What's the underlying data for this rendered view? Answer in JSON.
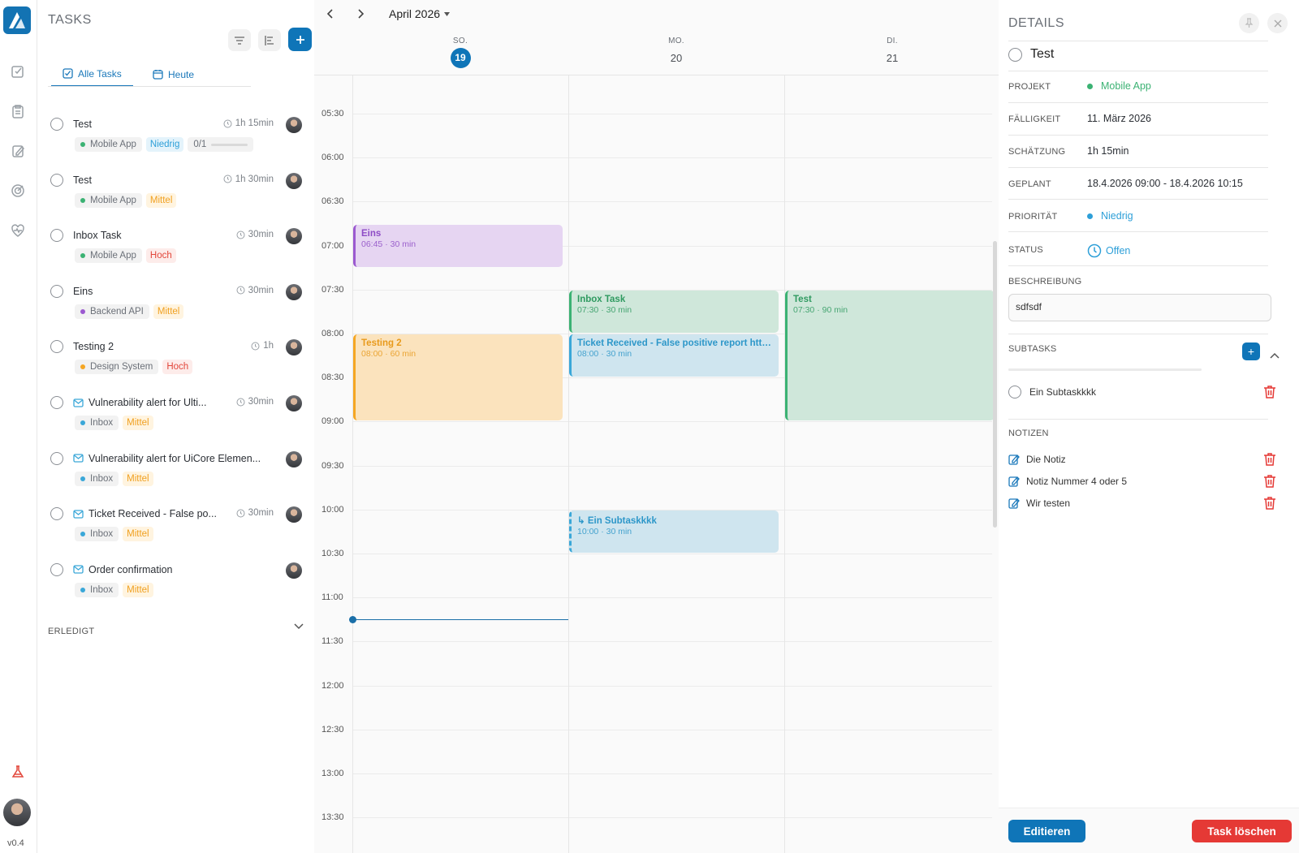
{
  "app": {
    "version": "v0.4",
    "colors": {
      "accent": "#0f75b8",
      "danger": "#e53935"
    }
  },
  "tasks_panel": {
    "title": "TASKS",
    "tabs": [
      {
        "label": "Alle Tasks",
        "icon": "checkbox-icon"
      },
      {
        "label": "Heute",
        "icon": "calendar-icon"
      }
    ],
    "items": [
      {
        "title": "Test",
        "time": "1h 15min",
        "project": "Mobile App",
        "project_color": "#3bb273",
        "priority": "Niedrig",
        "priority_color": "#2d9fd8",
        "priority_bg": "#e4f3fb",
        "progress": "0/1"
      },
      {
        "title": "Test",
        "time": "1h 30min",
        "project": "Mobile App",
        "project_color": "#3bb273",
        "priority": "Mittel",
        "priority_color": "#f0a020",
        "priority_bg": "#fff4e0"
      },
      {
        "title": "Inbox Task",
        "time": "30min",
        "project": "Mobile App",
        "project_color": "#3bb273",
        "priority": "Hoch",
        "priority_color": "#e2473b",
        "priority_bg": "#fdecea"
      },
      {
        "title": "Eins",
        "time": "30min",
        "project": "Backend API",
        "project_color": "#9b59d0",
        "priority": "Mittel",
        "priority_color": "#f0a020",
        "priority_bg": "#fff4e0"
      },
      {
        "title": "Testing 2",
        "time": "1h",
        "project": "Design System",
        "project_color": "#f5a623",
        "priority": "Hoch",
        "priority_color": "#e2473b",
        "priority_bg": "#fdecea"
      },
      {
        "title": "Vulnerability alert for Ulti...",
        "time": "30min",
        "project": "Inbox",
        "project_color": "#3aa7d8",
        "priority": "Mittel",
        "priority_color": "#f0a020",
        "priority_bg": "#fff4e0",
        "mail": true
      },
      {
        "title": "Vulnerability alert for UiCore Elemen...",
        "time": "",
        "project": "Inbox",
        "project_color": "#3aa7d8",
        "priority": "Mittel",
        "priority_color": "#f0a020",
        "priority_bg": "#fff4e0",
        "mail": true
      },
      {
        "title": "Ticket Received - False po...",
        "time": "30min",
        "project": "Inbox",
        "project_color": "#3aa7d8",
        "priority": "Mittel",
        "priority_color": "#f0a020",
        "priority_bg": "#fff4e0",
        "mail": true
      },
      {
        "title": "Order confirmation",
        "time": "",
        "project": "Inbox",
        "project_color": "#3aa7d8",
        "priority": "Mittel",
        "priority_color": "#f0a020",
        "priority_bg": "#fff4e0",
        "mail": true
      }
    ],
    "done_label": "ERLEDIGT"
  },
  "calendar": {
    "month": "April 2026",
    "days": [
      {
        "name": "SO.",
        "date": "19",
        "today": true
      },
      {
        "name": "MO.",
        "date": "20"
      },
      {
        "name": "DI.",
        "date": "21"
      }
    ],
    "times": [
      "05:30",
      "06:00",
      "06:30",
      "07:00",
      "07:30",
      "08:00",
      "08:30",
      "09:00",
      "09:30",
      "10:00",
      "10:30",
      "11:00",
      "11:30",
      "12:00",
      "12:30",
      "13:00",
      "13:30"
    ],
    "events": [
      {
        "name": "Eins",
        "meta": "06:45 · 30 min",
        "day": 0,
        "start": "06:45",
        "duration_min": 30,
        "color": "#9b59d0",
        "bg": "#e6d5f2",
        "fg": "#8e4cc6"
      },
      {
        "name": "Testing 2",
        "meta": "08:00 · 60 min",
        "day": 0,
        "start": "08:00",
        "duration_min": 60,
        "color": "#f5a623",
        "bg": "#fbe3bd",
        "fg": "#e89a1c"
      },
      {
        "name": "Inbox Task",
        "meta": "07:30 · 30 min",
        "day": 1,
        "start": "07:30",
        "duration_min": 30,
        "color": "#3bb273",
        "bg": "#cfe7da",
        "fg": "#2f9a60"
      },
      {
        "name": "Ticket Received - False positive report http...",
        "meta": "08:00 · 30 min",
        "day": 1,
        "start": "08:00",
        "duration_min": 30,
        "color": "#3aa7d8",
        "bg": "#cfe5ef",
        "fg": "#2d97c9"
      },
      {
        "name": "↳ Ein Subtaskkkk",
        "meta": "10:00 · 30 min",
        "day": 1,
        "start": "10:00",
        "duration_min": 30,
        "color": "#3aa7d8",
        "bg": "#cfe5ef",
        "fg": "#2d97c9",
        "dashed": true
      },
      {
        "name": "Test",
        "meta": "07:30 · 90 min",
        "day": 2,
        "start": "07:30",
        "duration_min": 90,
        "color": "#3bb273",
        "bg": "#cfe7da",
        "fg": "#2f9a60"
      }
    ],
    "now": "11:15"
  },
  "details": {
    "title": "DETAILS",
    "task_title": "Test",
    "fields": {
      "projekt": {
        "label": "PROJEKT",
        "value": "Mobile App",
        "color": "#3bb273"
      },
      "faelligkeit": {
        "label": "FÄLLIGKEIT",
        "value": "11. März 2026"
      },
      "schaetzung": {
        "label": "SCHÄTZUNG",
        "value": "1h 15min"
      },
      "geplant": {
        "label": "GEPLANT",
        "value": "18.4.2026 09:00 - 18.4.2026 10:15"
      },
      "prioritaet": {
        "label": "PRIORITÄT",
        "value": "Niedrig",
        "color": "#2d9fd8"
      },
      "status": {
        "label": "STATUS",
        "value": "Offen",
        "color": "#2d9fd8"
      }
    },
    "beschreibung_label": "BESCHREIBUNG",
    "beschreibung": "sdfsdf",
    "subtasks_label": "SUBTASKS",
    "subtasks": [
      {
        "title": "Ein Subtaskkkk"
      }
    ],
    "notizen_label": "NOTIZEN",
    "notes": [
      "Die Notiz",
      "Notiz Nummer 4 oder 5",
      "Wir testen"
    ],
    "edit_label": "Editieren",
    "delete_label": "Task löschen"
  }
}
